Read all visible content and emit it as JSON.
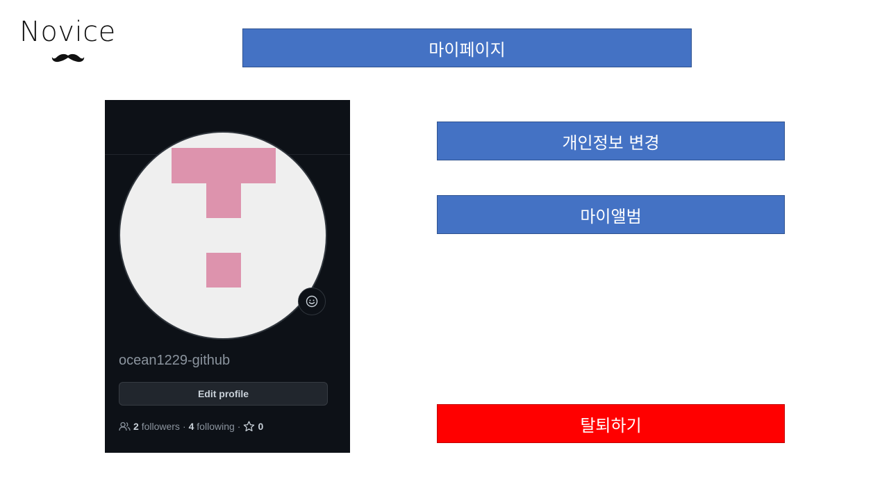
{
  "logo": {
    "text": "Novice",
    "icon": "mustache-icon"
  },
  "header": {
    "title": "마이페이지"
  },
  "menu": {
    "personal_info_label": "개인정보 변경",
    "my_album_label": "마이앨범",
    "withdraw_label": "탈퇴하기"
  },
  "profile": {
    "username": "ocean1229-github",
    "edit_label": "Edit profile",
    "followers_count": "2",
    "followers_label": "followers",
    "following_count": "4",
    "following_label": "following",
    "stars_count": "0",
    "separator": "·",
    "icons": [
      "people-icon",
      "star-icon",
      "smiley-icon",
      "identicon-avatar"
    ]
  },
  "colors": {
    "primary_blue": "#4472c4",
    "danger_red": "#ff0000",
    "card_bg": "#0d1117",
    "identicon_pink": "#dd93ad"
  }
}
